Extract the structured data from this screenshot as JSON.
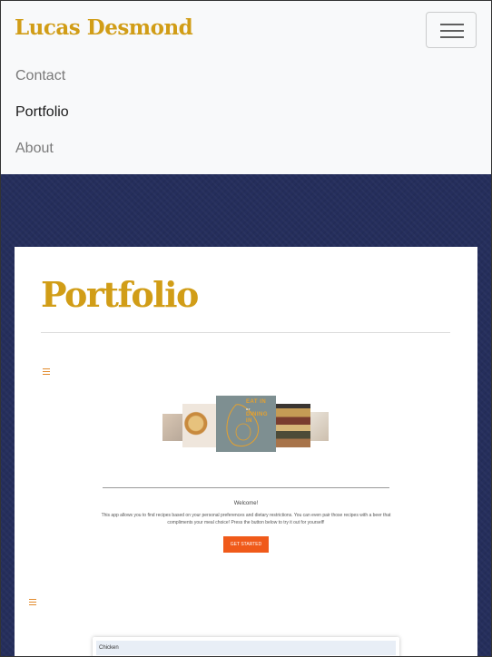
{
  "navbar": {
    "brand": "Lucas Desmond",
    "toggle_icon": "hamburger-icon",
    "links": [
      "Contact",
      "Portfolio",
      "About"
    ],
    "active_link": "Portfolio"
  },
  "portfolio": {
    "title": "Portfolio",
    "project1": {
      "menu_icon": "menu-icon",
      "logo_text": [
        "EAT IN",
        "or",
        "DINING IN"
      ],
      "welcome": "Welcome!",
      "description": "This app allows you to find recipes based on your personal preferences and dietary restrictions. You can even pair those recipes with a beer that compliments your meal choice! Press the button below to try it out for yourself!",
      "button_label": "GET STARTED"
    },
    "project2": {
      "menu_icon": "menu-icon",
      "list_item": "Chicken"
    }
  },
  "colors": {
    "brand": "#d19d17",
    "navbar_bg": "#f8f9fa",
    "page_bg": "#252e5c",
    "accent_button": "#f05a1a"
  }
}
